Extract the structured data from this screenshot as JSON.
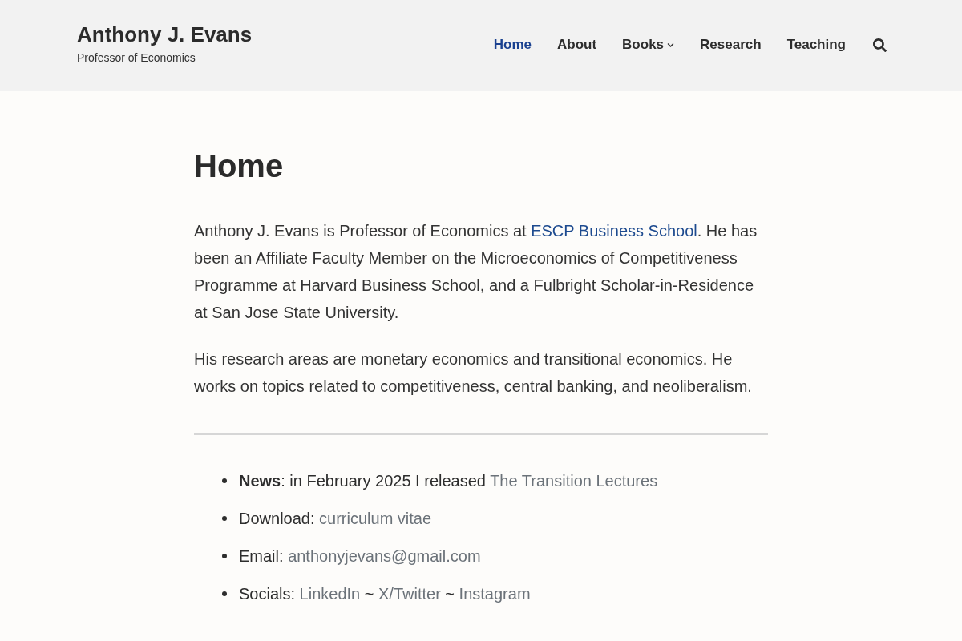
{
  "header": {
    "site_title": "Anthony J. Evans",
    "tagline": "Professor of Economics"
  },
  "nav": {
    "items": [
      {
        "label": "Home",
        "selected": true,
        "dropdown": false
      },
      {
        "label": "About",
        "selected": false,
        "dropdown": false
      },
      {
        "label": "Books",
        "selected": false,
        "dropdown": true
      },
      {
        "label": "Research",
        "selected": false,
        "dropdown": false
      },
      {
        "label": "Teaching",
        "selected": false,
        "dropdown": false
      }
    ]
  },
  "page": {
    "title": "Home",
    "paragraphs": [
      {
        "segments": [
          {
            "kind": "text",
            "text": "Anthony J. Evans is Professor of Economics at "
          },
          {
            "kind": "link",
            "text": "ESCP Business School"
          },
          {
            "kind": "text",
            "text": ". He has been an Affiliate Faculty Member on the Microeconomics of Competitiveness Programme at Harvard Business School, and a Fulbright Scholar-in-Residence at San Jose State University."
          }
        ]
      },
      {
        "segments": [
          {
            "kind": "text",
            "text": "His research areas are monetary economics and transitional economics. He works on topics related to competitiveness, central banking, and neoliberalism."
          }
        ]
      }
    ],
    "list": [
      {
        "segments": [
          {
            "kind": "bold",
            "text": "News"
          },
          {
            "kind": "text",
            "text": ": in February 2025 I released "
          },
          {
            "kind": "link",
            "text": "The Transition Lectures"
          }
        ]
      },
      {
        "segments": [
          {
            "kind": "text",
            "text": "Download: "
          },
          {
            "kind": "link",
            "text": "curriculum vitae"
          }
        ]
      },
      {
        "segments": [
          {
            "kind": "text",
            "text": "Email: "
          },
          {
            "kind": "link",
            "text": "anthonyjevans@gmail.com"
          }
        ]
      },
      {
        "segments": [
          {
            "kind": "text",
            "text": "Socials: "
          },
          {
            "kind": "link",
            "text": "LinkedIn"
          },
          {
            "kind": "text",
            "text": " ~ "
          },
          {
            "kind": "link",
            "text": "X/Twitter"
          },
          {
            "kind": "text",
            "text": " ~ "
          },
          {
            "kind": "link",
            "text": "Instagram"
          }
        ]
      }
    ]
  }
}
